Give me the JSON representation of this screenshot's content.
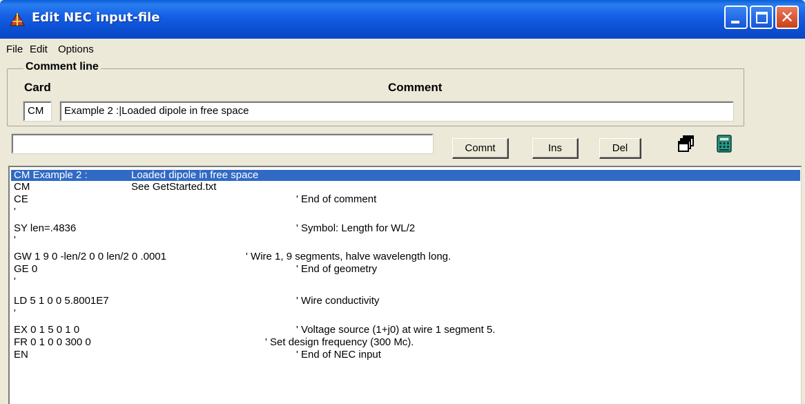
{
  "window": {
    "title": "Edit NEC input-file",
    "controls": {
      "minimize": "minimize",
      "maximize": "maximize",
      "close": "✕"
    }
  },
  "menu": [
    "File",
    "Edit",
    "Options"
  ],
  "comment_group": {
    "label": "Comment line",
    "card_header": "Card",
    "comment_header": "Comment",
    "card_value": "CM",
    "comment_value": "Example 2 :|Loaded dipole in free space"
  },
  "command_input": {
    "value": ""
  },
  "buttons": {
    "comment": "Comnt",
    "insert": "Ins",
    "delete": "Del"
  },
  "icons": [
    "windows-icon",
    "calculator-icon"
  ],
  "listing": [
    {
      "col1": "CM Example 2 :",
      "col2": "Loaded dipole in free space",
      "col3": "",
      "selected": true
    },
    {
      "col1": "CM",
      "col2": "See GetStarted.txt",
      "col3": ""
    },
    {
      "col1": "CE",
      "col2": "",
      "col3": "' End of comment"
    },
    {
      "col1": "'",
      "col2": "",
      "col3": ""
    },
    {
      "col1": "SY len=.4836",
      "col2": "",
      "col3": "' Symbol: Length for WL/2"
    },
    {
      "col1": "'",
      "col2": "",
      "col3": ""
    },
    {
      "col1": "GW 1 9 0 -len/2 0 0 len/2 0 .0001",
      "col2": "",
      "col3": "' Wire 1, 9 segments, halve wavelength long.",
      "wide": true
    },
    {
      "col1": "GE 0",
      "col2": "",
      "col3": "' End of geometry"
    },
    {
      "col1": "'",
      "col2": "",
      "col3": ""
    },
    {
      "col1": "LD 5 1 0 0 5.8001E7",
      "col2": "",
      "col3": "' Wire conductivity"
    },
    {
      "col1": "'",
      "col2": "",
      "col3": ""
    },
    {
      "col1": "EX 0 1 5 0 1 0",
      "col2": "",
      "col3": "' Voltage source (1+j0) at wire 1 segment 5."
    },
    {
      "col1": "FR 0 1 0 0 300 0",
      "col2": "",
      "col3": "' Set design frequency (300 Mc).",
      "mid": true
    },
    {
      "col1": "EN",
      "col2": "",
      "col3": "' End of NEC input"
    }
  ]
}
